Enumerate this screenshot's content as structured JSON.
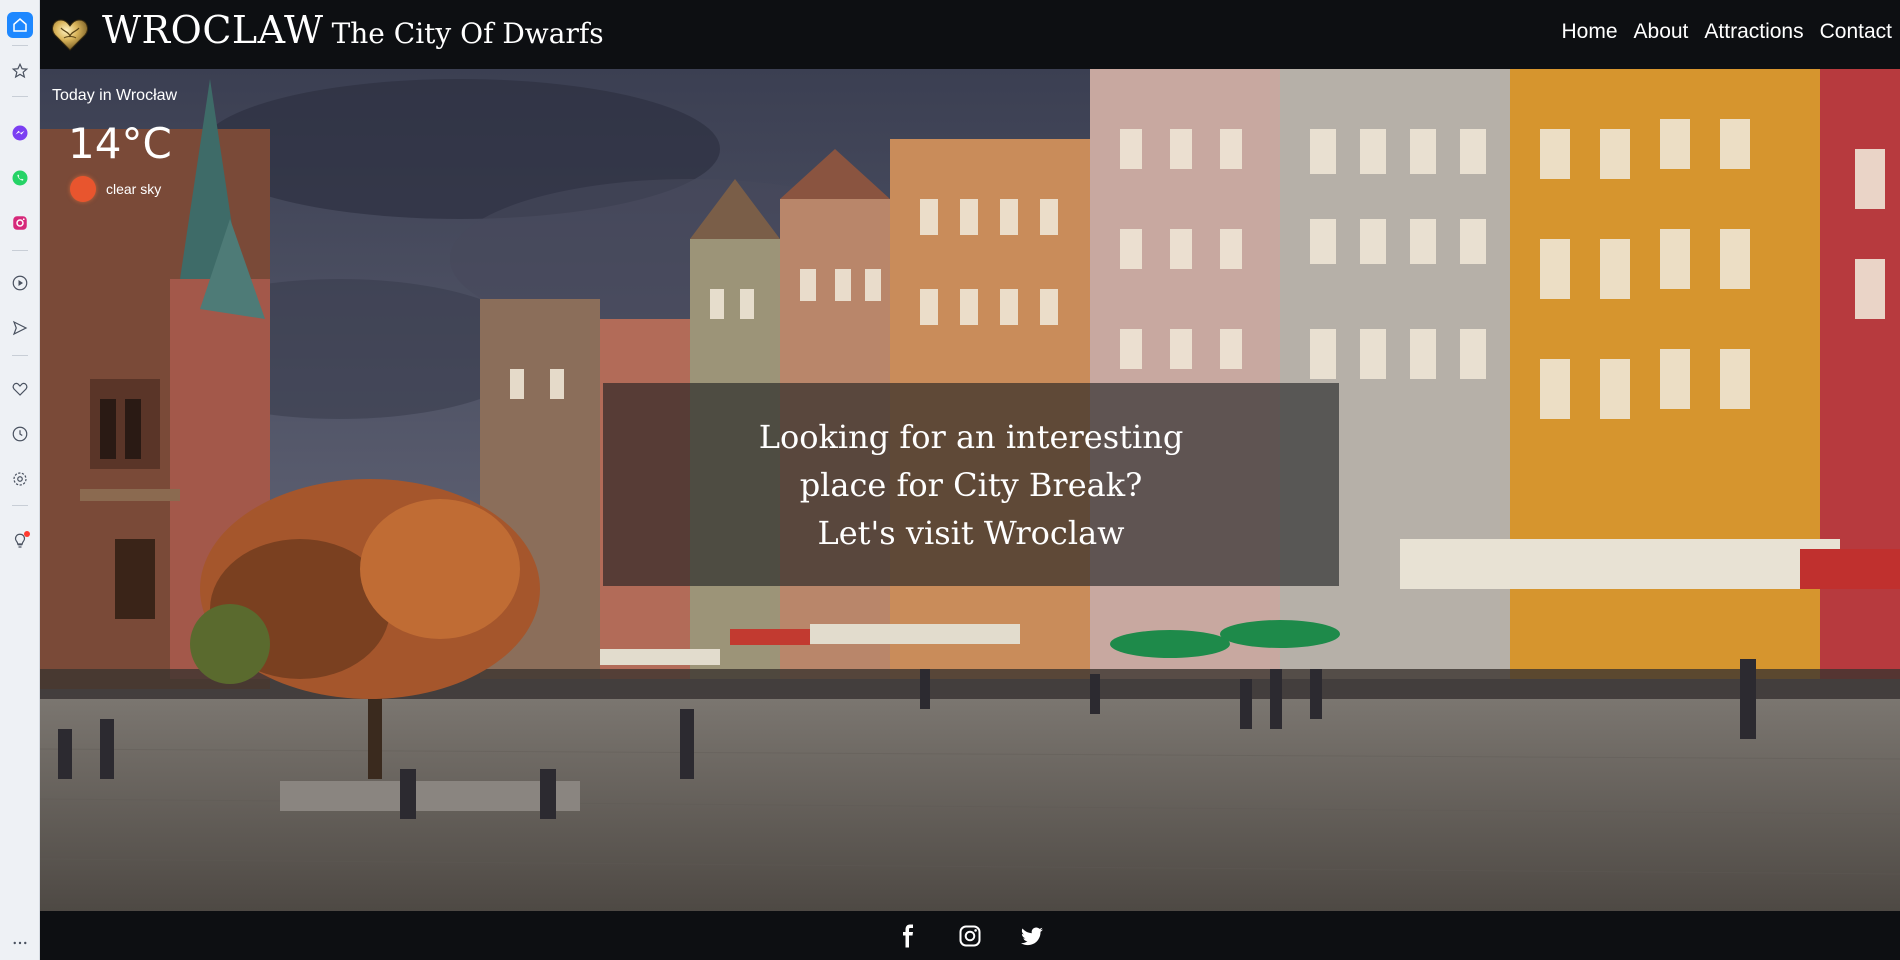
{
  "brand": {
    "name": "WROCLAW",
    "tagline": "The City Of Dwarfs"
  },
  "nav": [
    {
      "label": "Home"
    },
    {
      "label": "About"
    },
    {
      "label": "Attractions"
    },
    {
      "label": "Contact"
    }
  ],
  "weather": {
    "title": "Today in Wrocław",
    "temperature": "14°C",
    "description": "clear sky",
    "icon": "sun-icon"
  },
  "hero": {
    "lines": [
      "Looking for an interesting",
      "place for City Break?",
      "Let's visit Wroclaw"
    ]
  },
  "footer": {
    "social": [
      "facebook-icon",
      "instagram-icon",
      "twitter-icon"
    ]
  },
  "browser_sidebar": {
    "items": [
      "home-icon",
      "bookmark-icon",
      "messenger-icon",
      "whatsapp-icon",
      "instagram-icon",
      "play-icon",
      "send-icon",
      "heart-icon",
      "history-icon",
      "settings-icon",
      "lightbulb-icon",
      "more-icon"
    ]
  },
  "colors": {
    "accent": "#1e88ff",
    "nav_bg": "#0d0f12",
    "sun": "#e8552e"
  }
}
